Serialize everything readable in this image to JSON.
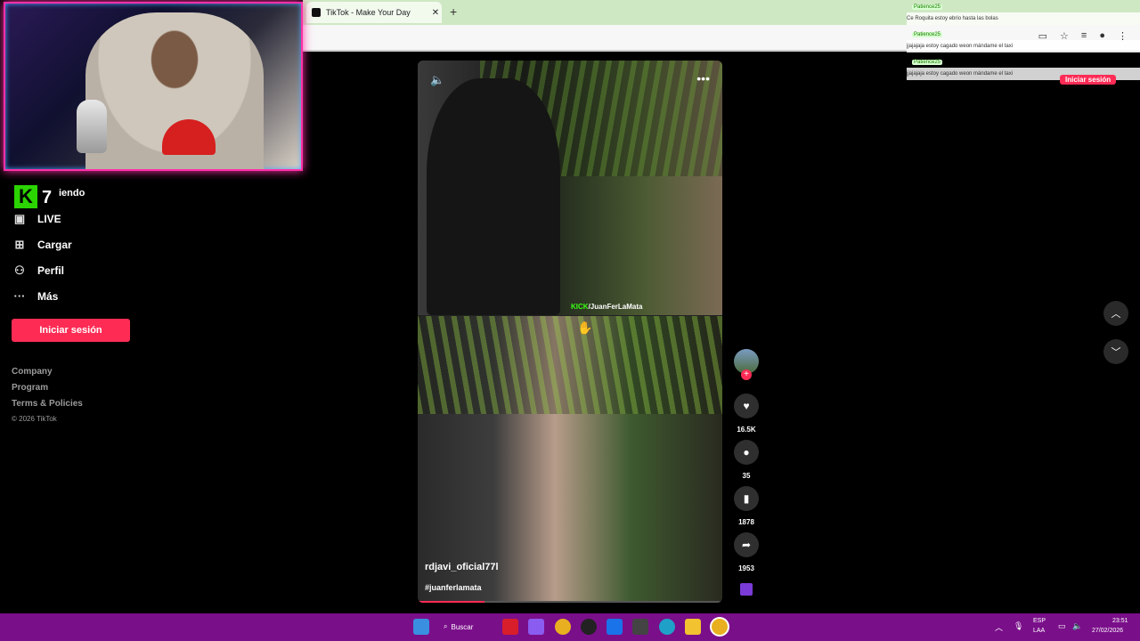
{
  "browser": {
    "tab_title": "TikTok - Make Your Day",
    "close_label": "✕",
    "new_tab_label": "+"
  },
  "stream": {
    "kick_logo": "K",
    "viewer_count": "7"
  },
  "sidebar": {
    "following_partial": "iendo",
    "items": [
      {
        "label": "LIVE",
        "icon": "live-icon"
      },
      {
        "label": "Cargar",
        "icon": "upload-icon"
      },
      {
        "label": "Perfil",
        "icon": "profile-icon"
      },
      {
        "label": "Más",
        "icon": "more-icon"
      }
    ],
    "login_button": "Iniciar sesión",
    "footer_links": [
      "Company",
      "Program",
      "Terms & Policies"
    ],
    "copyright": "© 2026 TikTok"
  },
  "video": {
    "watermark_top": "/JuanFerLaMata",
    "watermark_brand": "KICK",
    "watermark_bottom": "/JuanFerLaMata",
    "username": "rdjavi_oficial77l",
    "hashtag": "#juanferlamata",
    "progress": 0.22
  },
  "actions": {
    "likes": "16.5K",
    "comments": "35",
    "saves": "1878",
    "shares": "1953"
  },
  "chat": [
    {
      "user": "Patience25",
      "message": "Ce Roquita estoy ebrio hasta las bolas"
    },
    {
      "user": "Patience25",
      "message": "jjajajaja estoy cagado weon mándame el taxi"
    },
    {
      "user": "Patience25",
      "message": "jjajajaja estoy cagado weon mándame el taxi"
    }
  ],
  "tiktok_top": {
    "login_button": "Iniciar sesión"
  },
  "taskbar": {
    "search_label": "Buscar",
    "lang_top": "ESP",
    "lang_bottom": "LAA",
    "time": "23:51",
    "date": "27/02/2026"
  },
  "colors": {
    "brand_pink": "#fe2c55",
    "taskbar_purple": "#7a0f8a",
    "kick_green": "#2bd400"
  }
}
